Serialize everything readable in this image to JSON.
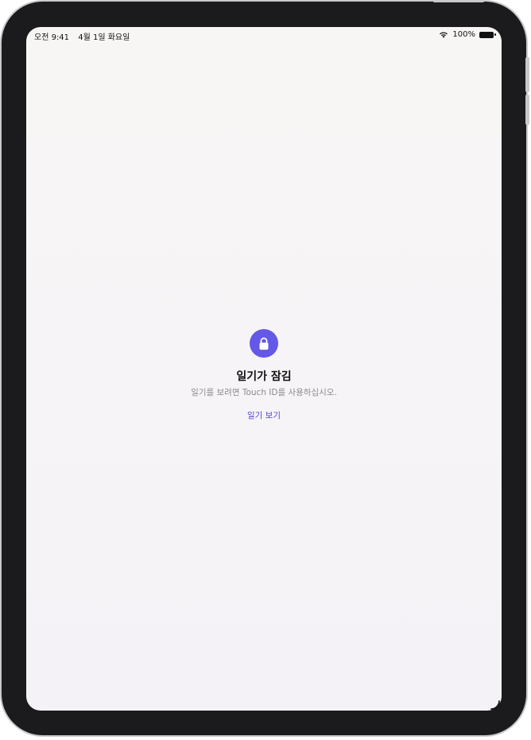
{
  "status_bar": {
    "time": "오전 9:41",
    "date": "4월 1일 화요일",
    "battery": "100%",
    "icons": [
      "wifi-icon",
      "battery-icon"
    ]
  },
  "lock_screen": {
    "icon": "lock-icon",
    "title": "일기가 잠김",
    "subtitle": "일기를 보려면 Touch ID를 사용하십시오.",
    "action_label": "일기 보기"
  },
  "colors": {
    "accent": "#6458e8",
    "link": "#5146d6",
    "subtitle": "#8a8a8e",
    "background": "#f8f6f5"
  }
}
